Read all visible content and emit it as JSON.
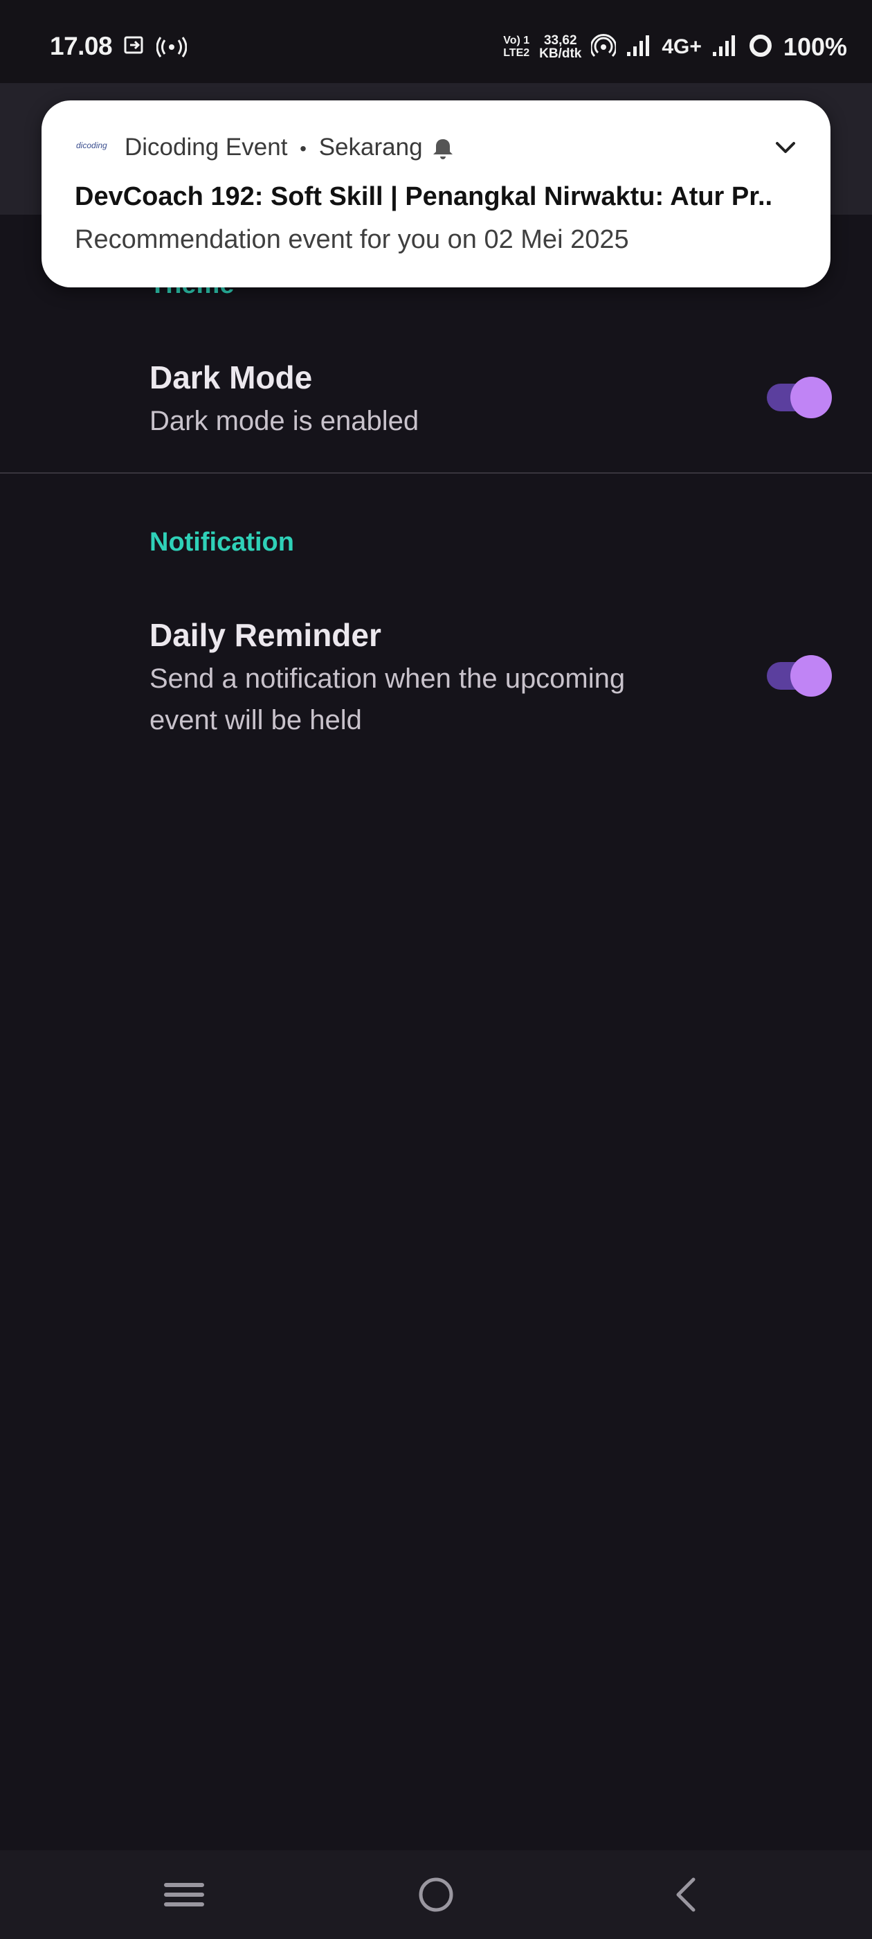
{
  "status_bar": {
    "time": "17.08",
    "volte_top": "Vo) 1",
    "volte_bottom": "LTE2",
    "speed_value": "33,62",
    "speed_unit": "KB/dtk",
    "network_type": "4G+",
    "battery": "100%",
    "icons": [
      "cast-icon",
      "radio-icon",
      "hotspot-icon",
      "signal-icon",
      "signal-icon-2",
      "battery-saver-icon"
    ]
  },
  "notification": {
    "app_logo_text": "dicoding",
    "app_name": "Dicoding Event",
    "separator": "•",
    "time": "Sekarang",
    "title": "DevCoach 192: Soft Skill | Penangkal Nirwaktu: Atur Pr..",
    "text": "Recommendation event for you on 02 Mei 2025",
    "icons": [
      "bell-icon",
      "chevron-down-icon"
    ]
  },
  "settings": {
    "theme_section": "Theme",
    "dark_mode_title": "Dark Mode",
    "dark_mode_summary": "Dark mode is enabled",
    "dark_mode_enabled": true,
    "notification_section": "Notification",
    "daily_reminder_title": "Daily Reminder",
    "daily_reminder_summary_line1": "Send a notification when the upcoming",
    "daily_reminder_summary_line2": "event will be held",
    "daily_reminder_enabled": true
  },
  "colors": {
    "background": "#15131a",
    "accent_section": "#2fd1b8",
    "switch_track": "#5b3f9e",
    "switch_thumb": "#c084f5"
  },
  "nav_bar": {
    "icons": [
      "menu-icon",
      "home-icon",
      "back-icon"
    ]
  }
}
